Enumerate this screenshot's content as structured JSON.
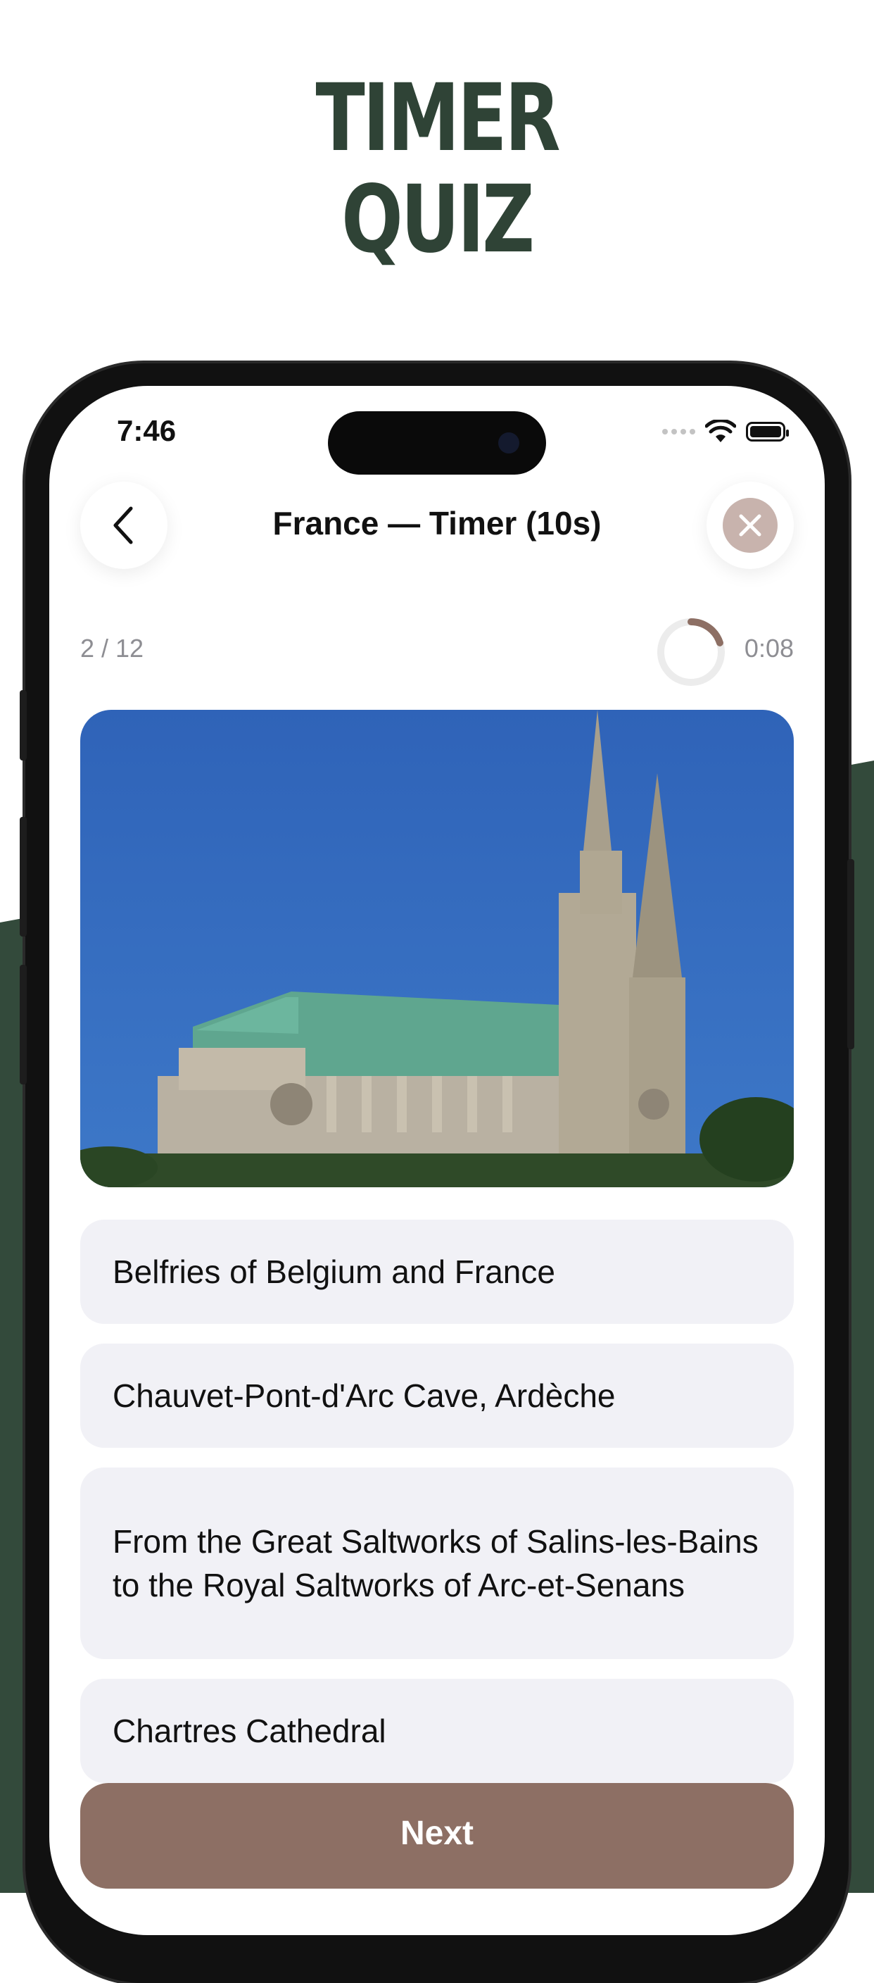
{
  "promo": {
    "title_line1": "TIMER",
    "title_line2": "QUIZ"
  },
  "status_bar": {
    "time": "7:46"
  },
  "header": {
    "title": "France — Timer (10s)"
  },
  "quiz": {
    "progress": "2 / 12",
    "timer": "0:08",
    "timer_fraction_remaining": 0.2,
    "image_description_icon": "cathedral-photo",
    "answers": [
      "Belfries of Belgium and France",
      "Chauvet-Pont-d'Arc Cave, Ardèche",
      "From the Great Saltworks of Salins-les-Bains to the Royal Saltworks of Arc-et-Senans",
      "Chartres Cathedral"
    ],
    "next_label": "Next"
  },
  "colors": {
    "brand_green": "#2f4336",
    "accent_brown": "#8d6f64",
    "close_bg": "#c8b3ad",
    "answer_bg": "#f1f1f6",
    "muted_text": "#8e8e93"
  }
}
